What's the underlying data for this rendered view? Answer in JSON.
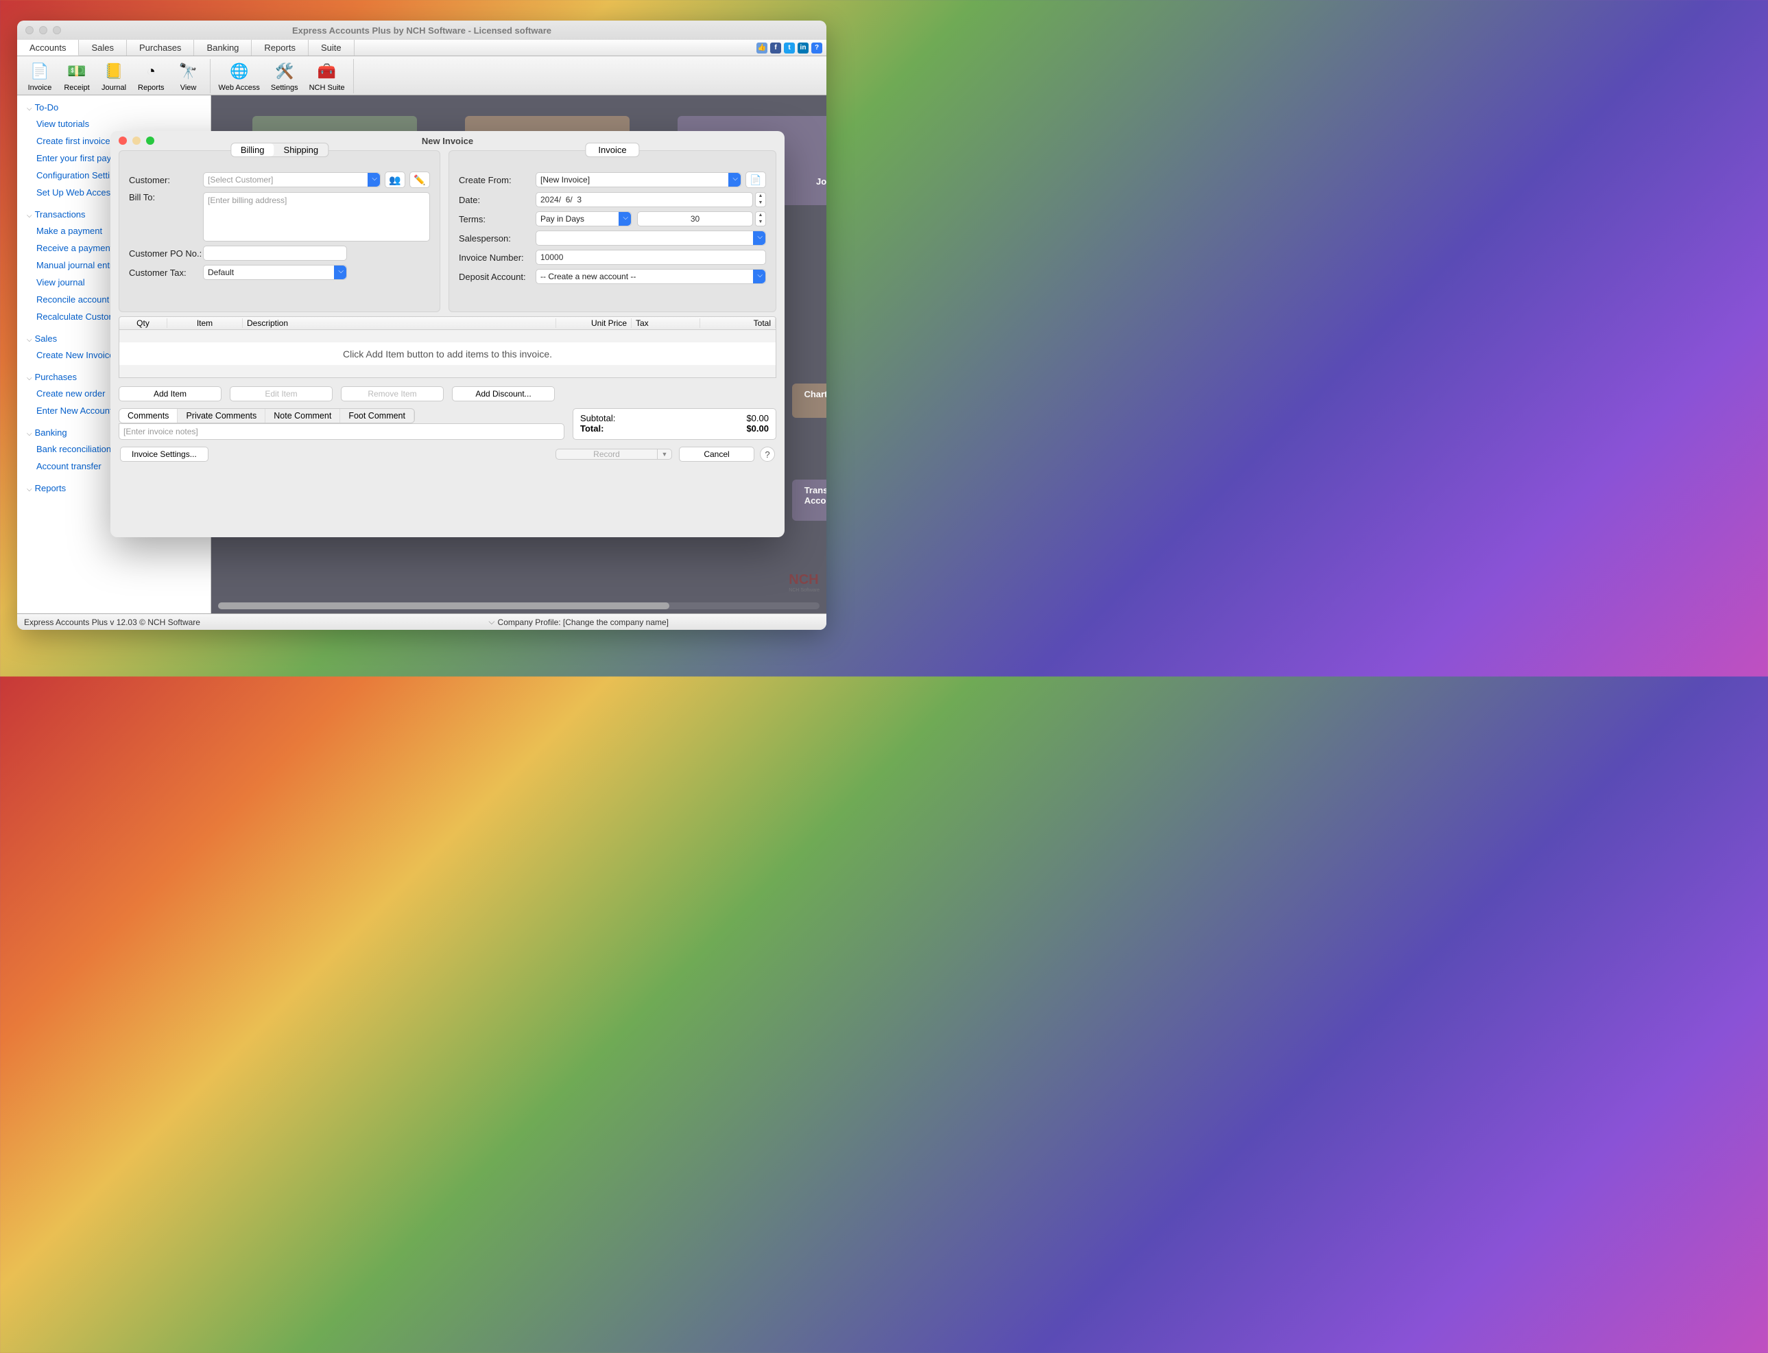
{
  "window_title": "Express Accounts Plus by NCH Software - Licensed software",
  "menu": {
    "accounts": "Accounts",
    "sales": "Sales",
    "purchases": "Purchases",
    "banking": "Banking",
    "reports": "Reports",
    "suite": "Suite"
  },
  "toolbar": {
    "invoice": "Invoice",
    "receipt": "Receipt",
    "journal": "Journal",
    "reports": "Reports",
    "view": "View",
    "web": "Web Access",
    "settings": "Settings",
    "suite": "NCH Suite"
  },
  "sidebar": {
    "todo": {
      "header": "To-Do",
      "items": [
        "View tutorials",
        "Create first invoice",
        "Enter your first pay",
        "Configuration Setti",
        "Set Up Web Access"
      ]
    },
    "transactions": {
      "header": "Transactions",
      "items": [
        "Make a payment",
        "Receive a payment",
        "Manual journal entr",
        "View journal",
        "Reconcile account",
        "Recalculate Custon"
      ]
    },
    "sales": {
      "header": "Sales",
      "items": [
        "Create New Invoice"
      ]
    },
    "purchases": {
      "header": "Purchases",
      "items": [
        "Create new order",
        "Enter New Account"
      ]
    },
    "banking": {
      "header": "Banking",
      "items": [
        "Bank reconciliation",
        "Account transfer"
      ]
    },
    "reports": {
      "header": "Reports"
    }
  },
  "cards": {
    "journal": "Journal",
    "chart": "Chart Of A",
    "transfer": "Transfer B\nAccounts"
  },
  "status": {
    "version": "Express Accounts Plus v 12.03 © NCH Software",
    "profile": "Company Profile: [Change the company name]"
  },
  "dialog": {
    "title": "New Invoice",
    "tabs": {
      "billing": "Billing",
      "shipping": "Shipping",
      "invoice": "Invoice"
    },
    "left": {
      "customer_label": "Customer:",
      "customer_placeholder": "[Select Customer]",
      "billto_label": "Bill To:",
      "billto_placeholder": "[Enter billing address]",
      "po_label": "Customer PO No.:",
      "tax_label": "Customer Tax:",
      "tax_value": "Default"
    },
    "right": {
      "createfrom_label": "Create From:",
      "createfrom_value": "[New Invoice]",
      "date_label": "Date:",
      "date_value": "2024/  6/  3",
      "terms_label": "Terms:",
      "terms_value": "Pay in Days",
      "terms_days": "30",
      "salesperson_label": "Salesperson:",
      "invno_label": "Invoice Number:",
      "invno_value": "10000",
      "deposit_label": "Deposit Account:",
      "deposit_value": "-- Create a new account --"
    },
    "grid": {
      "cols": {
        "qty": "Qty",
        "item": "Item",
        "desc": "Description",
        "unit": "Unit Price",
        "tax": "Tax",
        "total": "Total"
      },
      "empty": "Click Add Item button to add items to this invoice."
    },
    "buttons": {
      "add": "Add Item",
      "edit": "Edit Item",
      "remove": "Remove Item",
      "discount": "Add Discount..."
    },
    "comment_tabs": [
      "Comments",
      "Private Comments",
      "Note Comment",
      "Foot Comment"
    ],
    "notes_placeholder": "[Enter invoice notes]",
    "totals": {
      "sub_label": "Subtotal:",
      "sub_val": "$0.00",
      "tot_label": "Total:",
      "tot_val": "$0.00"
    },
    "footer": {
      "settings": "Invoice Settings...",
      "record": "Record",
      "cancel": "Cancel"
    }
  }
}
